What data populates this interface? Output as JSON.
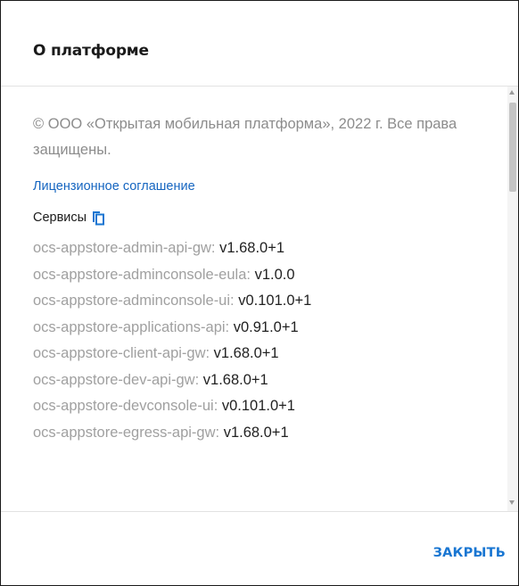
{
  "dialog": {
    "title": "О платформе",
    "copyright": "© ООО «Открытая мобильная платформа», 2022 г. Все права защищены.",
    "license_link": "Лицензионное соглашение",
    "services_label": "Сервисы",
    "services_copy_icon": "copy-icon",
    "services": [
      {
        "name": "ocs-appstore-admin-api-gw",
        "version": "v1.68.0+1"
      },
      {
        "name": "ocs-appstore-adminconsole-eula",
        "version": "v1.0.0"
      },
      {
        "name": "ocs-appstore-adminconsole-ui",
        "version": "v0.101.0+1"
      },
      {
        "name": "ocs-appstore-applications-api",
        "version": "v0.91.0+1"
      },
      {
        "name": "ocs-appstore-client-api-gw",
        "version": "v1.68.0+1"
      },
      {
        "name": "ocs-appstore-dev-api-gw",
        "version": "v1.68.0+1"
      },
      {
        "name": "ocs-appstore-devconsole-ui",
        "version": "v0.101.0+1"
      },
      {
        "name": "ocs-appstore-egress-api-gw",
        "version": "v1.68.0+1"
      }
    ],
    "close_label": "ЗАКРЫТЬ"
  },
  "colors": {
    "accent": "#1976d2",
    "link": "#1565c0",
    "muted_text": "#8c8c8c"
  }
}
